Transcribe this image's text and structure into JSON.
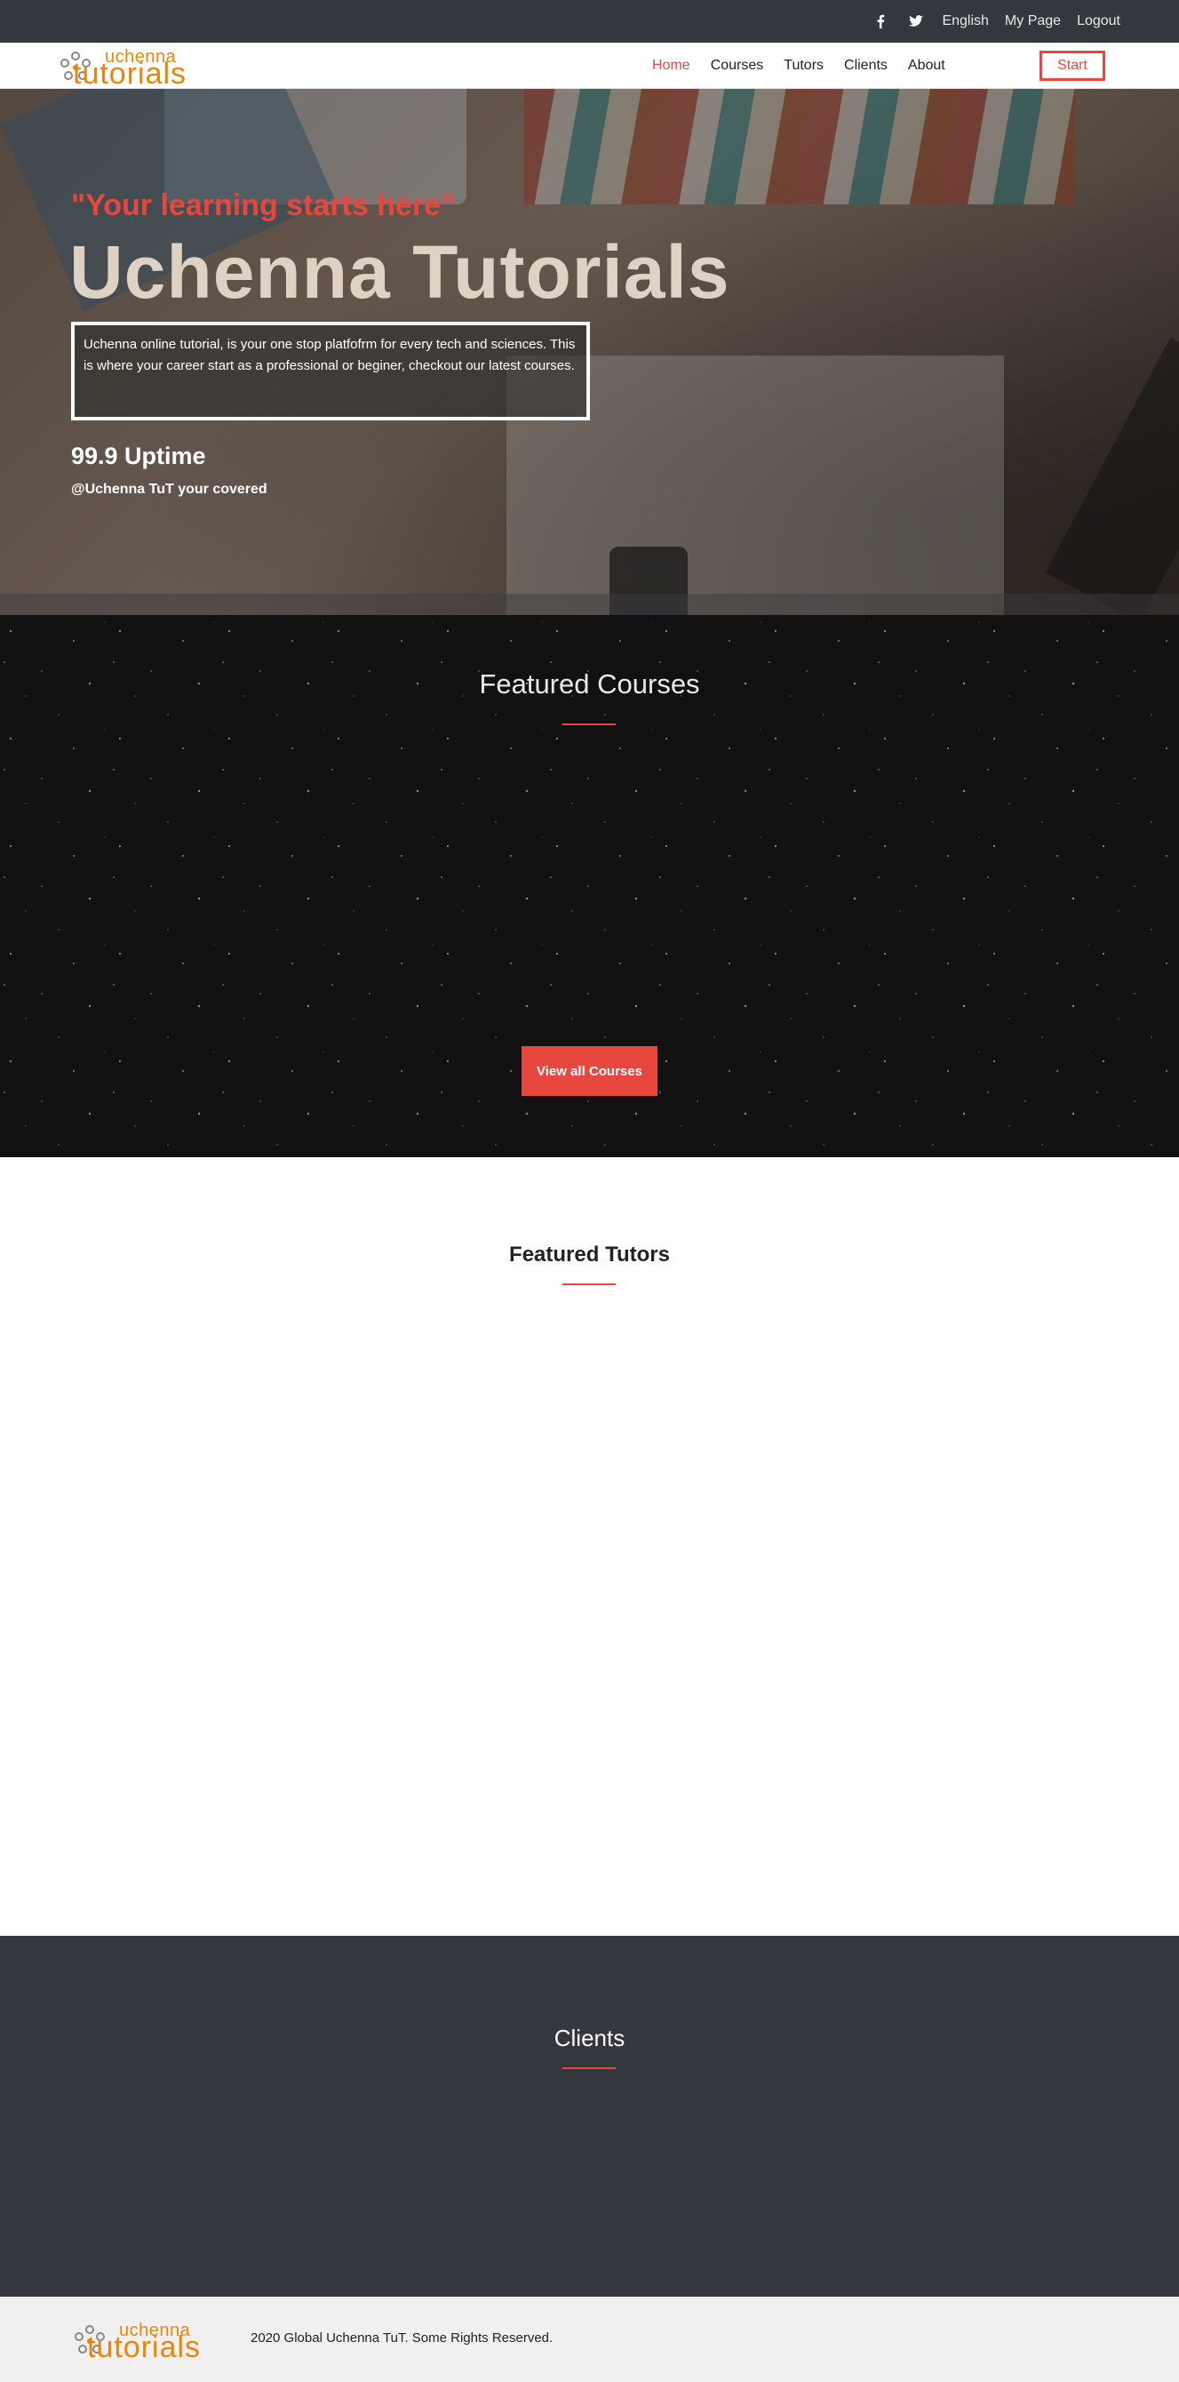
{
  "topbar": {
    "facebook_icon": "facebook-icon",
    "twitter_icon": "twitter-icon",
    "language": "English",
    "my_page": "My Page",
    "logout": "Logout"
  },
  "brand": {
    "logo_top": "uchenna",
    "logo_bottom": "tutorials"
  },
  "nav": {
    "items": [
      {
        "label": "Home",
        "active": true
      },
      {
        "label": "Courses",
        "active": false
      },
      {
        "label": "Tutors",
        "active": false
      },
      {
        "label": "Clients",
        "active": false
      },
      {
        "label": "About",
        "active": false
      }
    ],
    "start_label": "Start"
  },
  "hero": {
    "tagline": "\"Your learning starts here\"",
    "title": "Uchenna Tutorials",
    "description": "Uchenna online tutorial, is your one stop platfofrm for every tech and sciences. This is where your career start as a professional or beginer, checkout our latest courses.",
    "uptime": "99.9 Uptime",
    "covered": "@Uchenna TuT your covered"
  },
  "courses": {
    "title": "Featured Courses",
    "button_label": "View all Courses"
  },
  "tutors": {
    "title": "Featured Tutors"
  },
  "clients": {
    "title": "Clients"
  },
  "footer": {
    "copyright": "2020 Global Uchenna TuT. Some Rights Reserved."
  },
  "colors": {
    "accent": "#e8473e",
    "brand_orange": "#e8860a",
    "dark_bar": "#34373d",
    "footer_bg": "#f0f0f0"
  }
}
